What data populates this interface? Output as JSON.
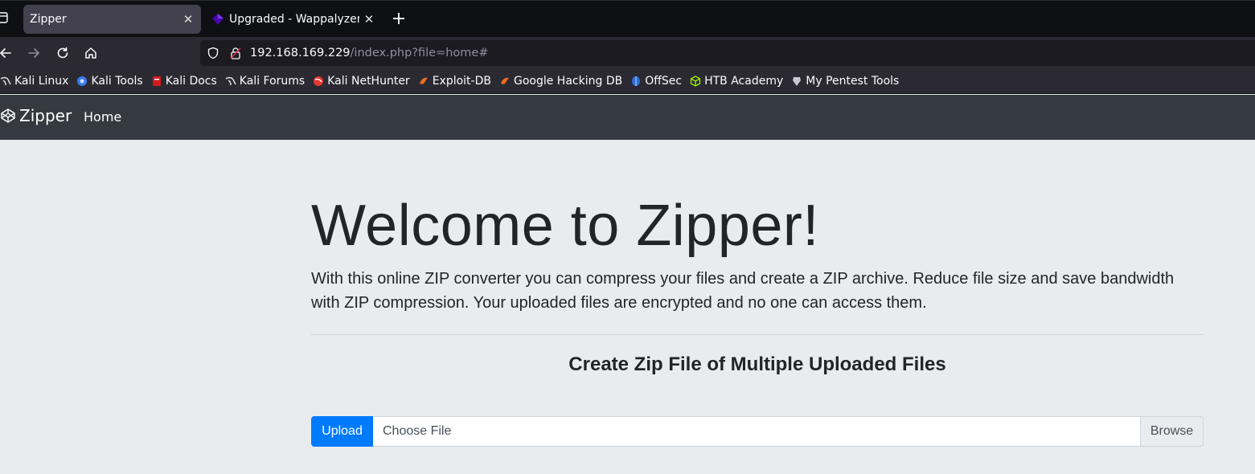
{
  "browser": {
    "tabs": [
      {
        "title": "Zipper",
        "active": true
      },
      {
        "title": "Upgraded - Wappalyzer",
        "active": false
      }
    ],
    "url": {
      "host": "192.168.169.229",
      "path": "/index.php?file=home#"
    },
    "bookmarks": [
      {
        "label": "Kali Linux",
        "icon": "kali-dragon-icon"
      },
      {
        "label": "Kali Tools",
        "icon": "kali-tools-icon"
      },
      {
        "label": "Kali Docs",
        "icon": "kali-docs-icon"
      },
      {
        "label": "Kali Forums",
        "icon": "kali-dragon-icon"
      },
      {
        "label": "Kali NetHunter",
        "icon": "nethunter-icon"
      },
      {
        "label": "Exploit-DB",
        "icon": "exploit-db-icon"
      },
      {
        "label": "Google Hacking DB",
        "icon": "ghdb-icon"
      },
      {
        "label": "OffSec",
        "icon": "offsec-icon"
      },
      {
        "label": "HTB Academy",
        "icon": "htb-cube-icon"
      },
      {
        "label": "My Pentest Tools",
        "icon": "pentest-tools-icon"
      }
    ]
  },
  "site": {
    "brand": "Zipper",
    "nav": {
      "home": "Home"
    },
    "heading": "Welcome to Zipper!",
    "lead": "With this online ZIP converter you can compress your files and create a ZIP archive. Reduce file size and save bandwidth with ZIP compression. Your uploaded files are encrypted and no one can access them.",
    "subheading": "Create Zip File of Multiple Uploaded Files",
    "upload": {
      "button": "Upload",
      "file_label": "Choose File",
      "browse": "Browse"
    }
  },
  "colors": {
    "primary": "#007bff",
    "navbar": "#343a40",
    "page_bg": "#e9ecef",
    "text": "#212529"
  }
}
